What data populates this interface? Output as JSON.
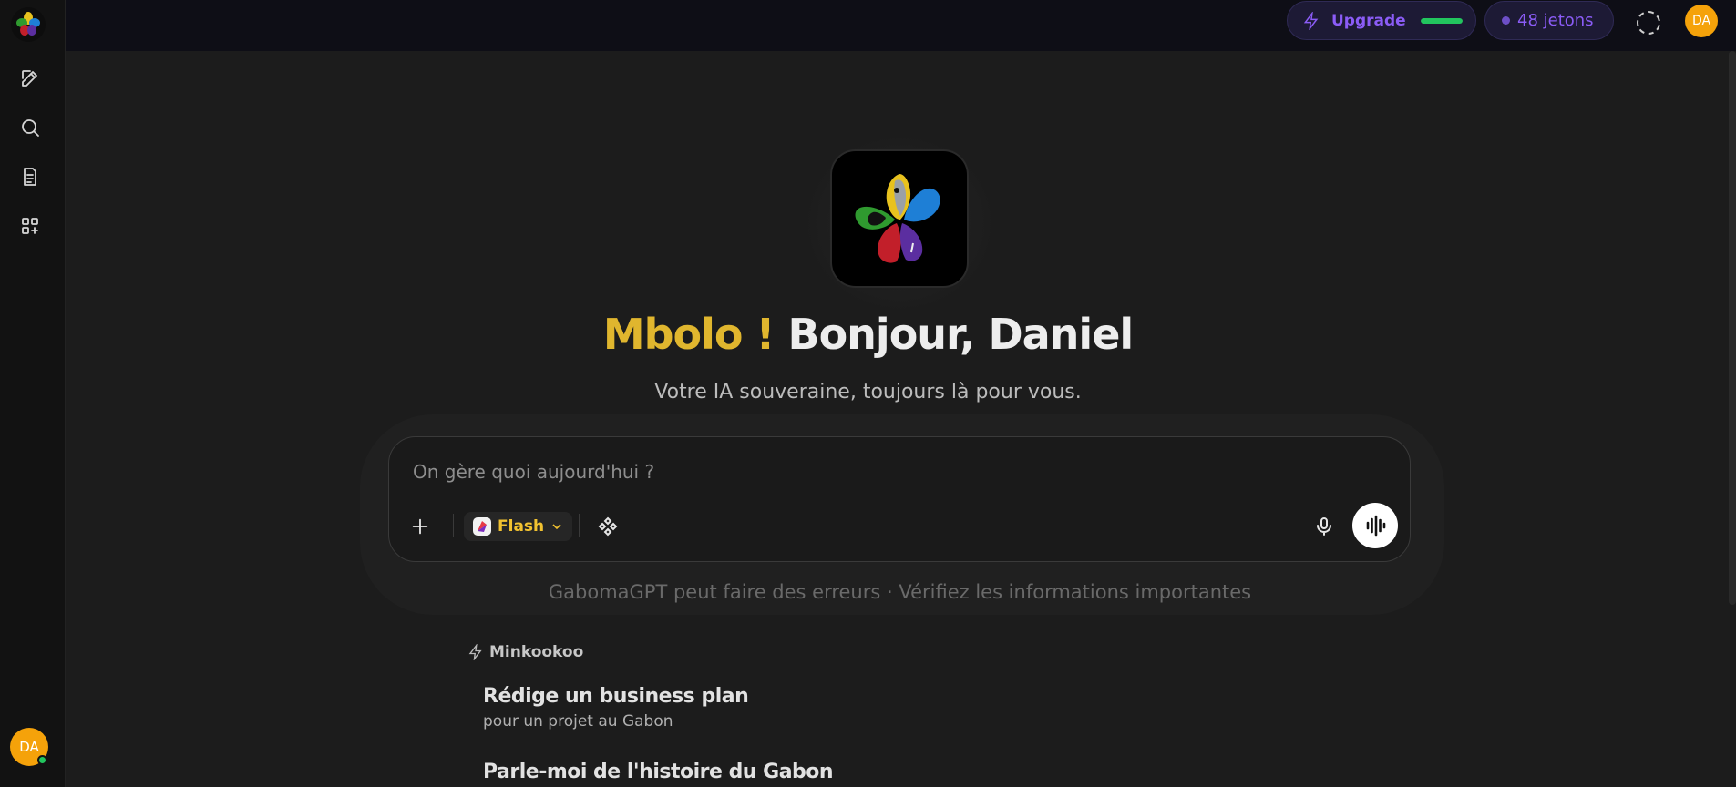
{
  "topbar": {
    "upgrade_label": "Upgrade",
    "upgrade_progress": 1.0,
    "tokens_label": "48 jetons",
    "avatar_initials": "DA"
  },
  "sidebar": {
    "items": [
      {
        "name": "new-chat",
        "icon": "edit-icon"
      },
      {
        "name": "search",
        "icon": "search-icon"
      },
      {
        "name": "documents",
        "icon": "document-icon"
      },
      {
        "name": "apps",
        "icon": "apps-grid-icon"
      }
    ],
    "avatar_initials": "DA"
  },
  "hero": {
    "greeting_accent": "Mbolo !",
    "greeting_name": "Bonjour, Daniel",
    "subtitle": "Votre IA souveraine, toujours là pour vous."
  },
  "composer": {
    "placeholder": "On gère quoi aujourd'hui ?",
    "model_label": "Flash"
  },
  "disclaimer": "GabomaGPT peut faire des erreurs · Vérifiez les informations importantes",
  "suggestions": {
    "heading": "Minkookoo",
    "items": [
      {
        "title": "Rédige un business plan",
        "subtitle": "pour un projet au Gabon"
      },
      {
        "title": "Parle-moi de l'histoire du Gabon",
        "subtitle": ""
      }
    ]
  },
  "colors": {
    "accent_gold": "#e0b62e",
    "upgrade_purple": "#8b5cf6",
    "avatar_orange": "#f5a20a",
    "online_green": "#22c55e"
  }
}
